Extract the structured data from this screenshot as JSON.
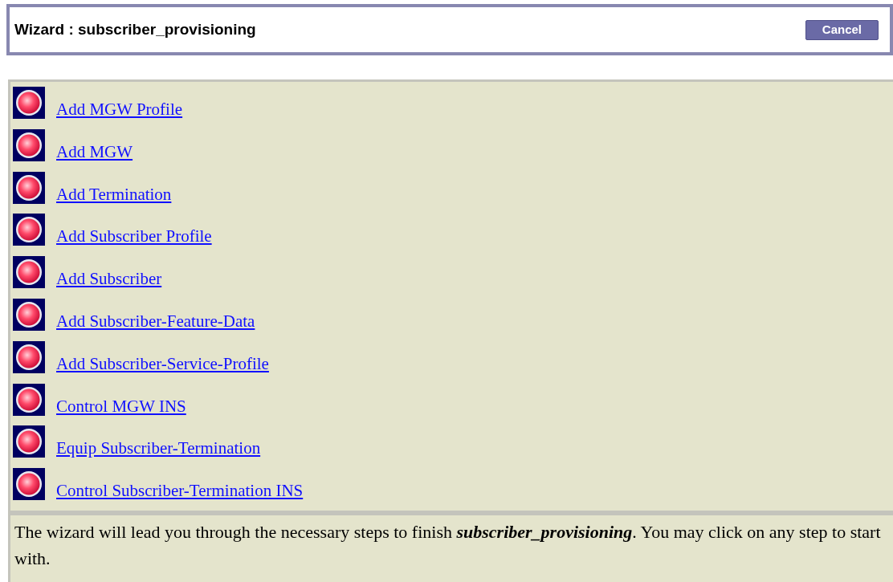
{
  "wizard": {
    "title": "Wizard : subscriber_provisioning",
    "cancel": "Cancel"
  },
  "steps": [
    {
      "label": "Add MGW Profile"
    },
    {
      "label": "Add MGW"
    },
    {
      "label": "Add Termination"
    },
    {
      "label": "Add Subscriber Profile"
    },
    {
      "label": "Add Subscriber"
    },
    {
      "label": "Add Subscriber-Feature-Data"
    },
    {
      "label": "Add Subscriber-Service-Profile"
    },
    {
      "label": "Control MGW INS"
    },
    {
      "label": "Equip Subscriber-Termination"
    },
    {
      "label": "Control Subscriber-Termination INS"
    }
  ],
  "description": "The wizard will lead you through the necessary steps to finish **subscriber_provisioning**. You may click on any step to start with."
}
